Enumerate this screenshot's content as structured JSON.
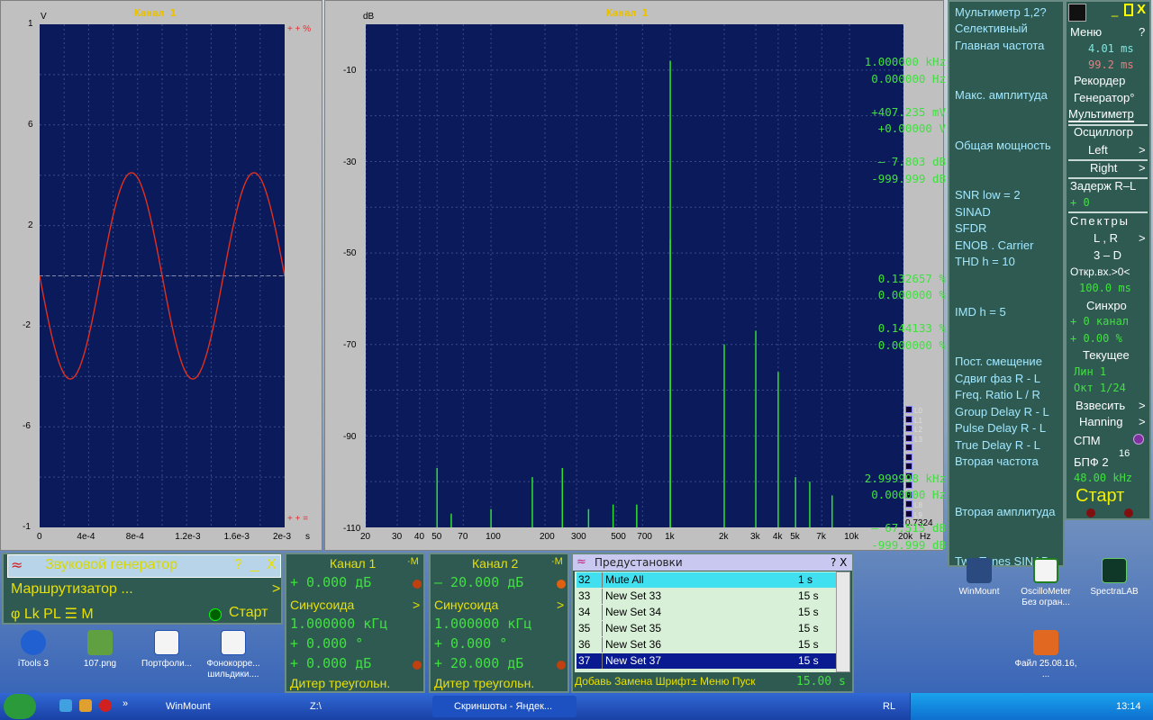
{
  "osc": {
    "title": "Канал 1",
    "yunit": "V",
    "xunit": "s",
    "yticks": [
      "1",
      "6",
      "2",
      "-2",
      "-6",
      "-1"
    ],
    "xticks": [
      "0",
      "4e-4",
      "8e-4",
      "1.2e-3",
      "1.6e-3",
      "2e-3"
    ],
    "top_right": "+ + %",
    "bot_right": "+ + ="
  },
  "spec": {
    "title": "Канал 1",
    "yunit": "dB",
    "xunit": "Hz",
    "yticks": [
      "-10",
      "-30",
      "-50",
      "-70",
      "-90",
      "-110"
    ],
    "xticks": [
      "20",
      "30",
      "40",
      "50",
      "70",
      "100",
      "200",
      "300",
      "500",
      "700",
      "1k",
      "2k",
      "3k",
      "4k",
      "5k",
      "7k",
      "10k",
      "20k"
    ],
    "legend": [
      "L0",
      "L1",
      "L2",
      "L3",
      "",
      "",
      "",
      "",
      "",
      "",
      "L8",
      "L9"
    ],
    "readout": "0.7324"
  },
  "multimeter": {
    "title": "Мультиметр 1,2?",
    "rows": [
      {
        "t": "Селективный"
      },
      {
        "t": "Главная частота"
      },
      {
        "v": "1.000000 kHz"
      },
      {
        "v": "0.000000  Hz"
      },
      {
        "t": "Макс. амплитуда"
      },
      {
        "v": "+407.235 mV"
      },
      {
        "v": "+0.00000  V"
      },
      {
        "t": "Общая мощность"
      },
      {
        "v": "–  7.803 dB"
      },
      {
        "v": "-999.999 dB"
      },
      {
        "t": "SNR      low =  2"
      },
      {
        "t": "SINAD"
      },
      {
        "t": "SFDR"
      },
      {
        "t": "ENOB . Carrier"
      },
      {
        "t": "THD       h = 10"
      },
      {
        "v": "0.132657 %"
      },
      {
        "v": "0.000000 %"
      },
      {
        "t": "IMD       h =  5"
      },
      {
        "v": "0.144133 %"
      },
      {
        "v": "0.000000 %"
      },
      {
        "t": "Пост. смещение"
      },
      {
        "t": "Сдвиг фаз R - L"
      },
      {
        "t": "Freq. Ratio  L / R"
      },
      {
        "t": "Group Delay R - L"
      },
      {
        "t": "Pulse Delay R - L"
      },
      {
        "t": "True Delay R - L"
      },
      {
        "t": "Вторая частота"
      },
      {
        "v": "2.999998 kHz"
      },
      {
        "v": "0.000000  Hz"
      },
      {
        "t": "Вторая амплитуда"
      },
      {
        "v": "–  67.515 dB"
      },
      {
        "v": "-999.999 dB"
      },
      {
        "t": "Two Tones SINAD"
      }
    ]
  },
  "menu": {
    "label": "Меню",
    "help": "?",
    "min": "_",
    "close": "X",
    "t1": "4.01 ms",
    "t2": "99.2 ms",
    "recorder": "Рекордер",
    "generator": "Генератор°",
    "multimeter": "Мультиметр",
    "oscillograph": "Осциллогр",
    "left": "Left",
    "right": "Right",
    "delay": "Задерж R–L",
    "delay_v": "+      0",
    "spectra": "Спектры",
    "lr": "L , R",
    "3d": "3 – D",
    "open": "Откр.вх.>0<",
    "open_v": "100.0 ms",
    "sync": "Синхро",
    "sync1": "+  0 канал",
    "sync2": "+  0.00 %",
    "current": "Текущее",
    "lin": "Лин      1",
    "oct": "Окт  1/24",
    "weigh": "Взвесить",
    "hanning": "Hanning",
    "spm": "СПМ",
    "fft": "БПФ  2",
    "fft_exp": "16",
    "fft_v": "48.00 kHz",
    "start": "Старт"
  },
  "gen": {
    "title": "Звуковой генератор",
    "help": "?",
    "min": "_",
    "close": "X",
    "router": "Маршрутизатор ...",
    "mode": "φ Lk PL ☰ M",
    "start": "Старт"
  },
  "ch1": {
    "title": "Канал 1",
    "m": "·M",
    "level": "+   0.000 дБ",
    "wave": "Синусоида",
    "freq": "1.000000 кГц",
    "phase": "+   0.000 °",
    "amp": "+   0.000 дБ",
    "dither": "Дитер треугольн."
  },
  "ch2": {
    "title": "Канал 2",
    "m": "·M",
    "level": "–  20.000 дБ",
    "wave": "Синусоида",
    "freq": "1.000000 кГц",
    "phase": "+   0.000 °",
    "amp": "+  20.000 дБ",
    "dither": "Дитер треугольн."
  },
  "presets": {
    "title": "Предустановки",
    "help": "? X",
    "rows": [
      {
        "n": "32",
        "name": "Mute All",
        "t": "1 s"
      },
      {
        "n": "33",
        "name": "New Set 33",
        "t": "15 s"
      },
      {
        "n": "34",
        "name": "New Set 34",
        "t": "15 s"
      },
      {
        "n": "35",
        "name": "New Set 35",
        "t": "15 s"
      },
      {
        "n": "36",
        "name": "New Set 36",
        "t": "15 s"
      },
      {
        "n": "37",
        "name": "New Set 37",
        "t": "15 s"
      }
    ],
    "footer": "Добавь Замена Шрифт± Меню Пуск",
    "time": "15.00 s"
  },
  "icons": {
    "itools": "iTools 3",
    "png": "107.png",
    "portfolio": "Портфоли...",
    "phono": "Фонокорре... шильдики....",
    "winmount": "WinMount",
    "oscillo": "OscilloMeter Без огран...",
    "spectralab": "SpectraLAB",
    "file": "Файл 25.08.16, ..."
  },
  "taskbar": {
    "more": "»",
    "winmount": "WinMount",
    "z": "Z:\\",
    "explorer": "Скриншоты - Яндек...",
    "lang": "RL",
    "clock": "13:14"
  },
  "chart_data": [
    {
      "type": "line",
      "title": "Канал 1",
      "ylabel": "V",
      "xlabel": "s",
      "ylim": [
        -1,
        1
      ],
      "xlim": [
        0,
        0.002
      ],
      "series": [
        {
          "values": "sine 1 kHz, amplitude ≈0.41 V"
        }
      ],
      "y_ticks": [
        "1",
        "6",
        "2",
        "-2",
        "-6",
        "-1"
      ],
      "x_ticks": [
        "0",
        "4e-4",
        "8e-4",
        "1.2e-3",
        "1.6e-3",
        "2e-3"
      ]
    },
    {
      "type": "bar",
      "title": "Канал 1",
      "ylabel": "dB",
      "xlabel": "Hz",
      "ylim": [
        -110,
        0
      ],
      "xscale": "log",
      "xlim": [
        20,
        20000
      ],
      "peaks": [
        [
          50,
          -97
        ],
        [
          60,
          -107
        ],
        [
          100,
          -106
        ],
        [
          170,
          -99
        ],
        [
          250,
          -97
        ],
        [
          350,
          -106
        ],
        [
          480,
          -105
        ],
        [
          650,
          -105
        ],
        [
          1000,
          -8
        ],
        [
          1000,
          -47
        ],
        [
          2000,
          -70
        ],
        [
          3000,
          -67
        ],
        [
          4000,
          -76
        ],
        [
          5000,
          -99
        ],
        [
          6000,
          -100
        ],
        [
          8000,
          -103
        ]
      ]
    }
  ]
}
